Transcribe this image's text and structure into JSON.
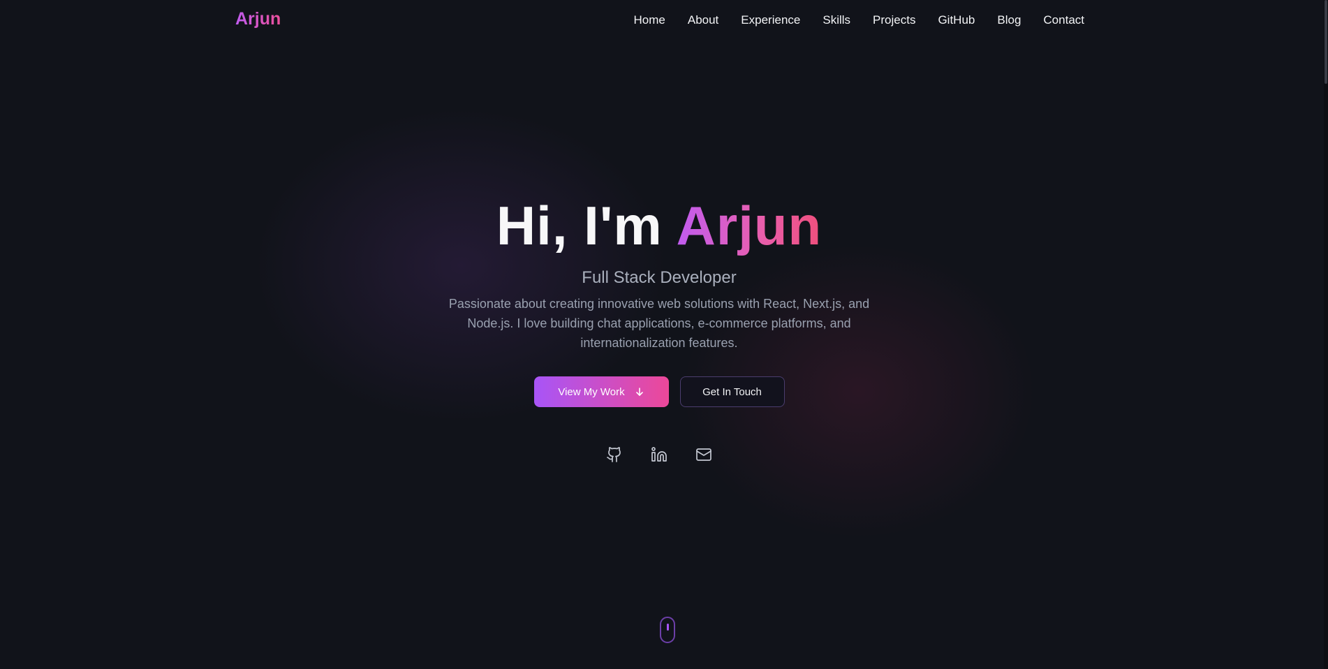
{
  "nav": {
    "logo": "Arjun",
    "links": [
      "Home",
      "About",
      "Experience",
      "Skills",
      "Projects",
      "GitHub",
      "Blog",
      "Contact"
    ]
  },
  "hero": {
    "greeting": "Hi, I'm ",
    "name": "Arjun",
    "role": "Full Stack Developer",
    "description": "Passionate about creating innovative web solutions with React, Next.js, and Node.js. I love building chat applications, e-commerce platforms, and internationalization features.",
    "primary_button": "View My Work",
    "secondary_button": "Get In Touch"
  },
  "social": [
    "github-icon",
    "linkedin-icon",
    "mail-icon"
  ],
  "colors": {
    "background": "#11131a",
    "accent_start": "#a855f7",
    "accent_end": "#ec4899"
  }
}
